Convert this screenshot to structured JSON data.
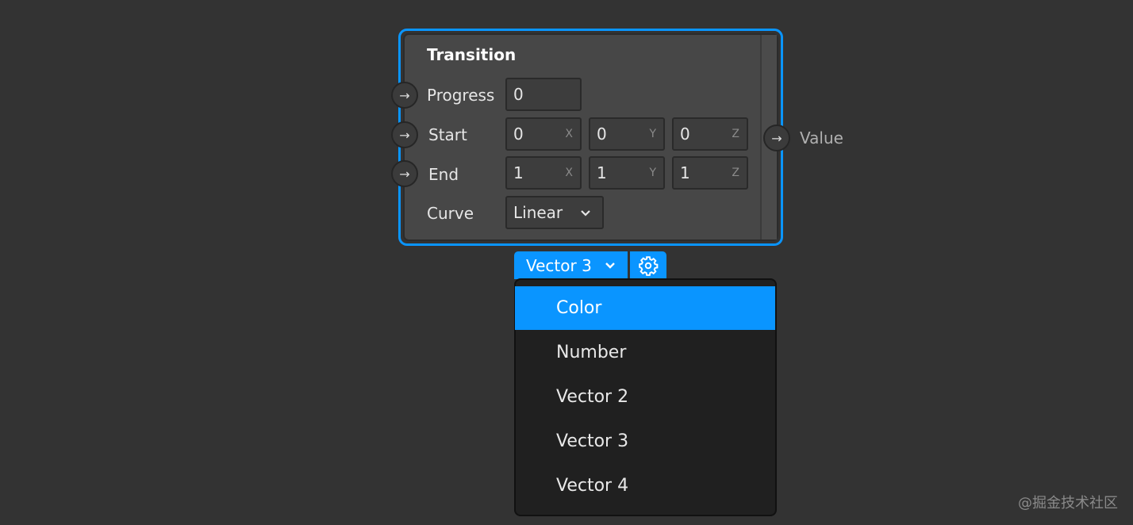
{
  "node": {
    "title": "Transition",
    "inputs": {
      "progress": {
        "label": "Progress",
        "value": "0"
      },
      "start": {
        "label": "Start",
        "x": "0",
        "y": "0",
        "z": "0"
      },
      "end": {
        "label": "End",
        "x": "1",
        "y": "1",
        "z": "1"
      },
      "curve": {
        "label": "Curve",
        "value": "Linear"
      }
    },
    "axis_labels": {
      "x": "X",
      "y": "Y",
      "z": "Z"
    },
    "output": {
      "label": "Value"
    }
  },
  "toolbar": {
    "type_select": "Vector 3",
    "settings_icon": "gear-icon"
  },
  "menu": {
    "items": [
      "Color",
      "Number",
      "Vector 2",
      "Vector 3",
      "Vector 4"
    ],
    "highlighted": "Color"
  },
  "watermark": "@掘金技术社区",
  "colors": {
    "accent": "#0a95ff",
    "background": "#333333",
    "node": "#474747",
    "menu": "#202020"
  }
}
